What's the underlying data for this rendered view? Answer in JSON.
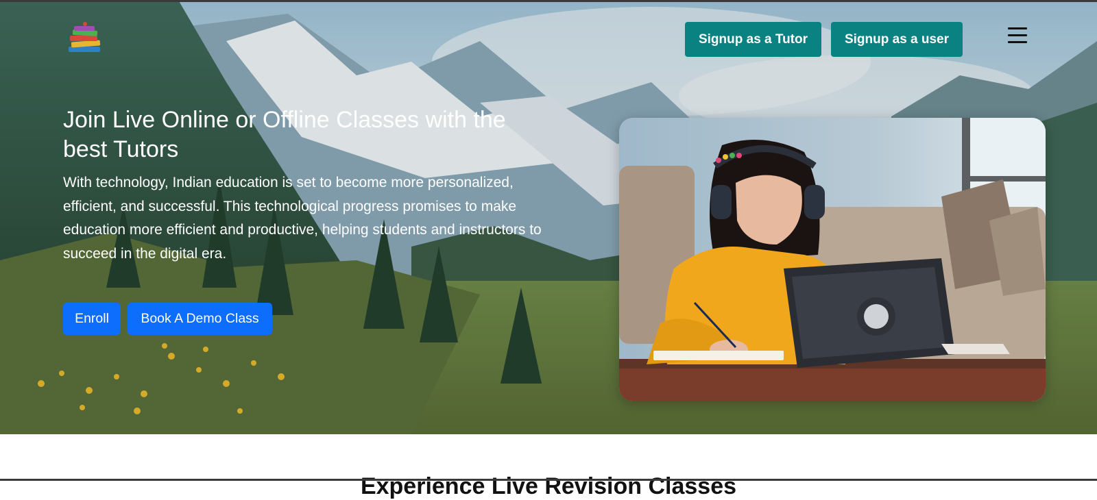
{
  "header": {
    "logo_icon": "books-stack-icon",
    "signup_tutor_label": "Signup as a Tutor",
    "signup_user_label": "Signup as a user",
    "menu_icon": "hamburger-menu-icon"
  },
  "hero": {
    "title": "Join Live Online or Offline Classes with the best Tutors",
    "description": "With technology, Indian education is set to become more personalized, efficient, and successful. This technological progress promises to make education more efficient and productive, helping students and instructors to succeed in the digital era.",
    "enroll_label": "Enroll",
    "demo_label": "Book A Demo Class",
    "background_image": "mountain-landscape-image",
    "photo": "girl-studying-with-tablet-image"
  },
  "next_section": {
    "heading": "Experience Live Revision Classes"
  },
  "colors": {
    "nav_button": "#0a8281",
    "cta_button": "#0d6efd",
    "text_light": "#ffffff"
  }
}
